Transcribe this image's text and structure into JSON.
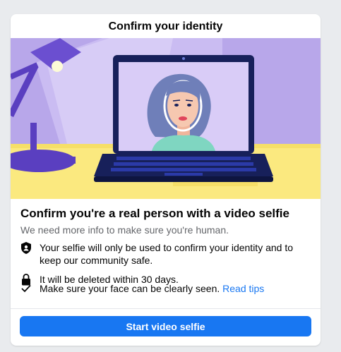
{
  "dialog": {
    "title": "Confirm your identity"
  },
  "content": {
    "heading": "Confirm you're a real person with a video selfie",
    "subtitle": "We need more info to make sure you're human.",
    "items": [
      {
        "icon": "shield-person-icon",
        "text": "Your selfie will only be used to confirm your identity and to keep our community safe."
      },
      {
        "icon": "lock-icon",
        "text": "It will be deleted within 30 days."
      },
      {
        "icon": "checkmark-icon",
        "text": "Make sure your face can be clearly seen.",
        "link": "Read tips"
      }
    ]
  },
  "actions": {
    "primary": "Start video selfie"
  },
  "colors": {
    "accent": "#1877f2",
    "illustration_purple": "#b8a7ea",
    "illustration_yellow": "#fbe97f",
    "laptop_navy": "#17205a"
  }
}
